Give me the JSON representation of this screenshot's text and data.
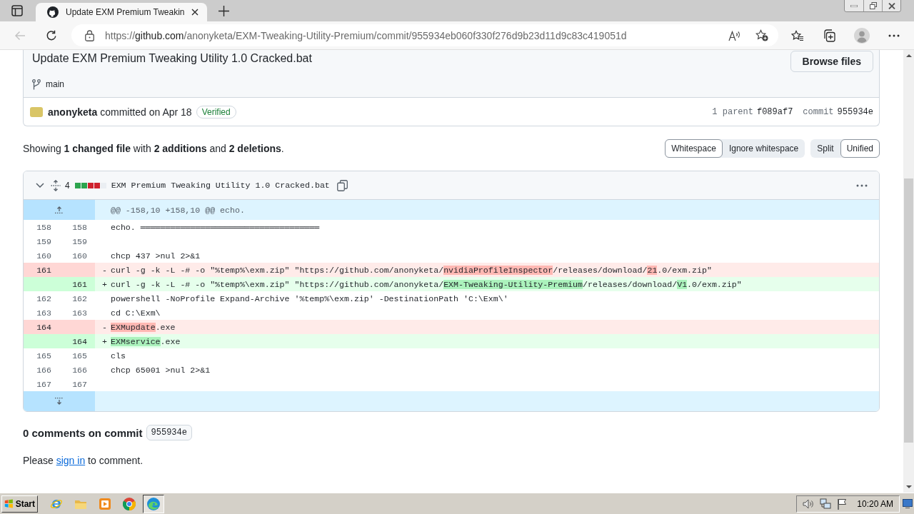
{
  "browser": {
    "tabs": [
      {
        "title": "Update EXM Premium Tweakin",
        "selected": true
      }
    ],
    "back_button": {
      "disabled": true
    },
    "address": {
      "scheme": "https://",
      "host": "github.com",
      "path": "/anonyketa/EXM-Tweaking-Utility-Premium/commit/955934eb060f330f276d9b23d11d9c83c419051d"
    }
  },
  "commit": {
    "title": "Update EXM Premium Tweaking Utility 1.0 Cracked.bat",
    "browse_button": "Browse files",
    "branch": "main",
    "author": "anonyketa",
    "committed": "committed on Apr 18",
    "badge": "Verified",
    "parent_label": "1 parent",
    "parent_sha": "f089af7",
    "commit_label": "commit",
    "commit_sha": "955934e"
  },
  "diff_toolbar": {
    "summary": "Showing **1 changed file** with **2 additions** and **2 deletions**.",
    "whitespace_options": [
      {
        "label": "Whitespace",
        "selected": true
      },
      {
        "label": "Ignore whitespace",
        "selected": false
      }
    ],
    "view_options": [
      {
        "label": "Split",
        "selected": false
      },
      {
        "label": "Unified",
        "selected": true
      }
    ]
  },
  "file": {
    "expanded": true,
    "change_count": "4",
    "diffstat": [
      {
        "kind": "added"
      },
      {
        "kind": "added"
      },
      {
        "kind": "deleted"
      },
      {
        "kind": "deleted"
      },
      {
        "kind": "neutral"
      }
    ],
    "filename": "EXM Premium Tweaking Utility 1.0 Cracked.bat",
    "hunk": "@@ -158,10 +158,10 @@ echo.",
    "lines": [
      {
        "kind": "context",
        "old": "158",
        "new": "158",
        "segments": [
          {
            "text": "echo. ════════════════════════════════════",
            "changed": false
          }
        ]
      },
      {
        "kind": "context",
        "old": "159",
        "new": "159"
      },
      {
        "kind": "context",
        "old": "160",
        "new": "160",
        "segments": [
          {
            "text": "chcp 437 >nul 2>&1",
            "changed": false
          }
        ]
      },
      {
        "kind": "deletion",
        "old": "161",
        "marker": "-",
        "segments": [
          {
            "text": "curl -g -k -L -# -o \"%temp%\\exm.zip\" \"https://github.com/anonyketa/",
            "changed": false
          },
          {
            "text": "nvidiaProfileInspector",
            "changed": true
          },
          {
            "text": "/releases/download/",
            "changed": false
          },
          {
            "text": "21",
            "changed": true
          },
          {
            "text": ".0/exm.zip\"",
            "changed": false
          }
        ]
      },
      {
        "kind": "addition",
        "new": "161",
        "marker": "+",
        "segments": [
          {
            "text": "curl -g -k -L -# -o \"%temp%\\exm.zip\" \"https://github.com/anonyketa/",
            "changed": false
          },
          {
            "text": "EXM-Tweaking-Utility-Premium",
            "changed": true
          },
          {
            "text": "/releases/download/",
            "changed": false
          },
          {
            "text": "V1",
            "changed": true
          },
          {
            "text": ".0/exm.zip\"",
            "changed": false
          }
        ]
      },
      {
        "kind": "context",
        "old": "162",
        "new": "162",
        "segments": [
          {
            "text": "powershell -NoProfile Expand-Archive '%temp%\\exm.zip' -DestinationPath 'C:\\Exm\\'",
            "changed": false
          }
        ]
      },
      {
        "kind": "context",
        "old": "163",
        "new": "163",
        "segments": [
          {
            "text": "cd C:\\Exm\\",
            "changed": false
          }
        ]
      },
      {
        "kind": "deletion",
        "old": "164",
        "marker": "-",
        "segments": [
          {
            "text": "EXMupdate",
            "changed": true
          },
          {
            "text": ".exe",
            "changed": false
          }
        ]
      },
      {
        "kind": "addition",
        "new": "164",
        "marker": "+",
        "segments": [
          {
            "text": "EXMservice",
            "changed": true
          },
          {
            "text": ".exe",
            "changed": false
          }
        ]
      },
      {
        "kind": "context",
        "old": "165",
        "new": "165",
        "segments": [
          {
            "text": "cls",
            "changed": false
          }
        ]
      },
      {
        "kind": "context",
        "old": "166",
        "new": "166",
        "segments": [
          {
            "text": "chcp 65001 >nul 2>&1",
            "changed": false
          }
        ]
      },
      {
        "kind": "context",
        "old": "167",
        "new": "167"
      }
    ]
  },
  "comments": {
    "heading": "0 comments on commit",
    "sha": "955934e",
    "before": "Please",
    "link": "sign in",
    "after": "to comment."
  },
  "taskbar": {
    "start": "Start",
    "apps": [
      {
        "kind": "ie",
        "selected": false
      },
      {
        "kind": "folder",
        "selected": false
      },
      {
        "kind": "media",
        "selected": false
      },
      {
        "kind": "chrome",
        "selected": false
      },
      {
        "kind": "edge",
        "selected": true
      }
    ],
    "clock": "10:20 AM"
  }
}
